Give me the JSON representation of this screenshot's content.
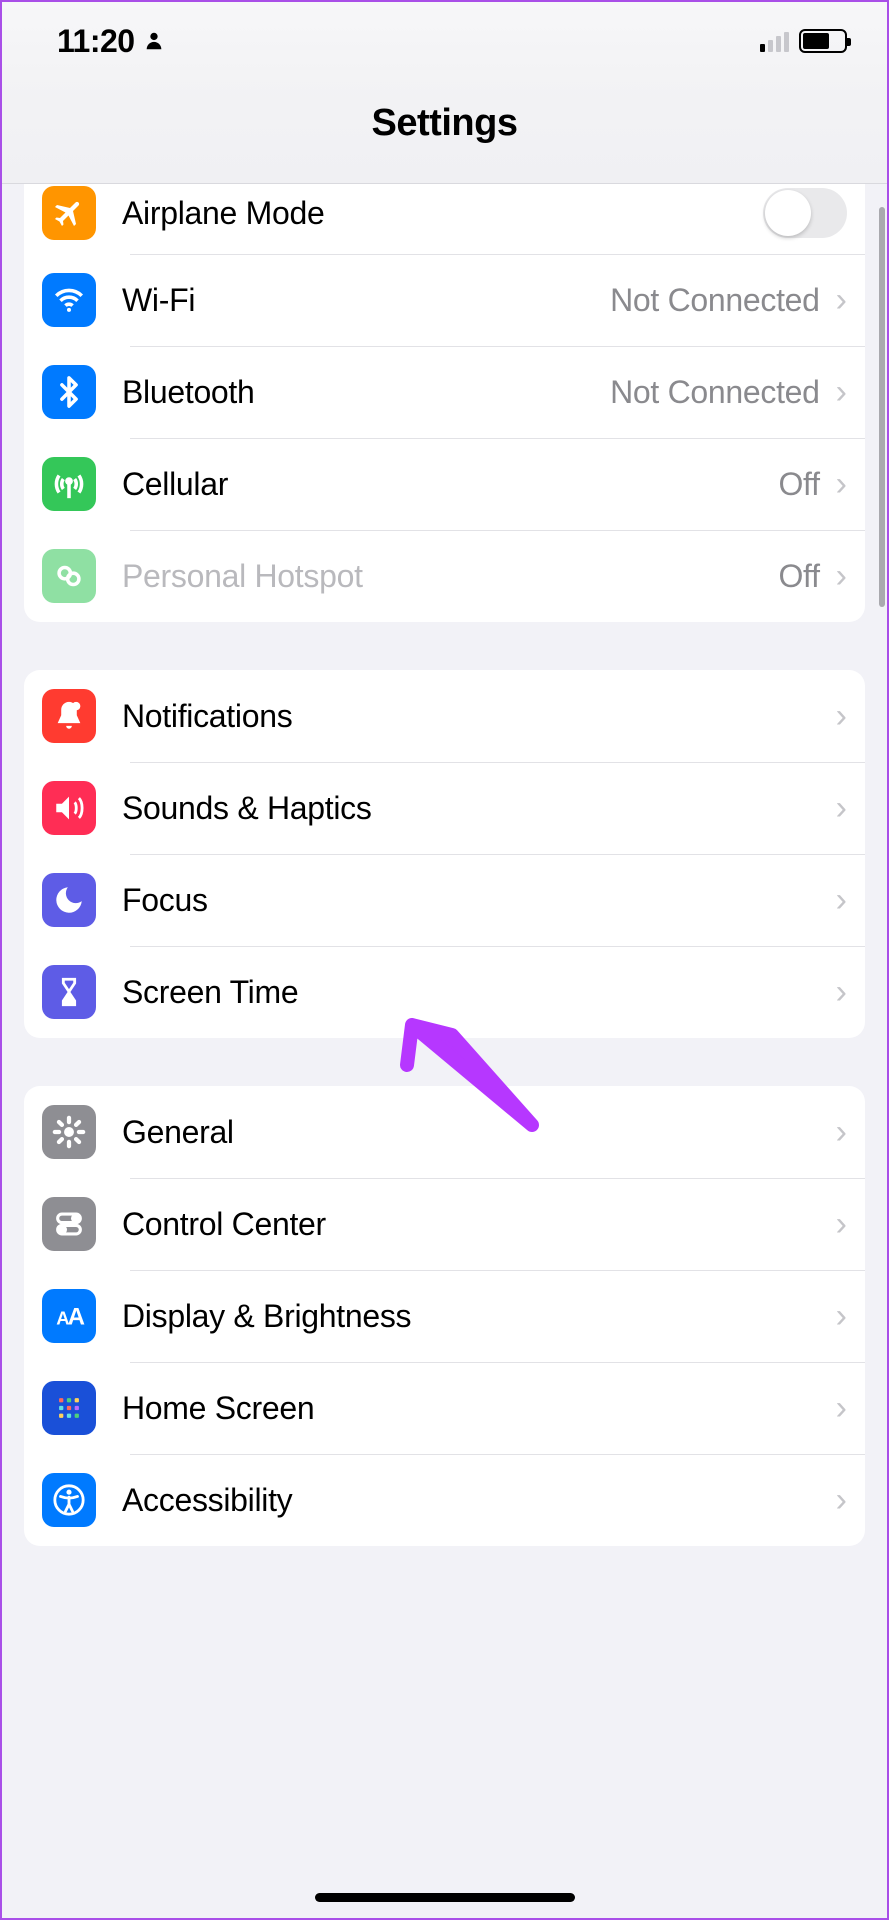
{
  "status": {
    "time": "11:20"
  },
  "header": {
    "title": "Settings"
  },
  "groups": [
    {
      "id": "connectivity",
      "cells": [
        {
          "id": "airplane",
          "label": "Airplane Mode",
          "value": null,
          "toggle": false,
          "iconColor": "#ff9500",
          "disabled": false
        },
        {
          "id": "wifi",
          "label": "Wi-Fi",
          "value": "Not Connected",
          "iconColor": "#007aff",
          "disabled": false
        },
        {
          "id": "bluetooth",
          "label": "Bluetooth",
          "value": "Not Connected",
          "iconColor": "#007aff",
          "disabled": false
        },
        {
          "id": "cellular",
          "label": "Cellular",
          "value": "Off",
          "iconColor": "#34c759",
          "disabled": false
        },
        {
          "id": "hotspot",
          "label": "Personal Hotspot",
          "value": "Off",
          "iconColor": "#34c759",
          "disabled": true
        }
      ]
    },
    {
      "id": "alerts",
      "cells": [
        {
          "id": "notifications",
          "label": "Notifications",
          "iconColor": "#ff3b30"
        },
        {
          "id": "sounds",
          "label": "Sounds & Haptics",
          "iconColor": "#ff2d55"
        },
        {
          "id": "focus",
          "label": "Focus",
          "iconColor": "#5e5ce6"
        },
        {
          "id": "screentime",
          "label": "Screen Time",
          "iconColor": "#5e5ce6"
        }
      ]
    },
    {
      "id": "general",
      "cells": [
        {
          "id": "general",
          "label": "General",
          "iconColor": "#8e8e93"
        },
        {
          "id": "controlcenter",
          "label": "Control Center",
          "iconColor": "#8e8e93"
        },
        {
          "id": "display",
          "label": "Display & Brightness",
          "iconColor": "#007aff"
        },
        {
          "id": "homescreen",
          "label": "Home Screen",
          "iconColor": "#1a50d8"
        },
        {
          "id": "accessibility",
          "label": "Accessibility",
          "iconColor": "#007aff"
        }
      ]
    }
  ],
  "annotation": {
    "arrowColor": "#b637ff"
  }
}
